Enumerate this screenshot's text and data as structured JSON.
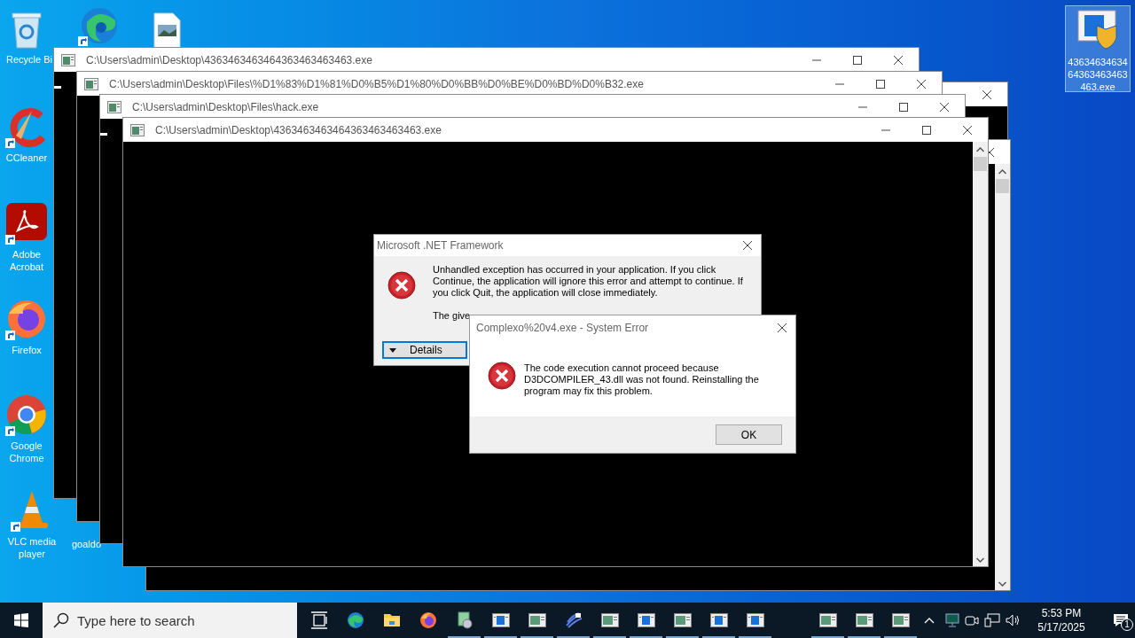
{
  "desktop_icons": [
    {
      "kind": "recycle-bin",
      "label": "Recycle Bi",
      "selected": false
    },
    {
      "kind": "edge",
      "selected": false
    },
    {
      "kind": "image-file",
      "selected": false
    },
    {
      "kind": "ccleaner",
      "label": "CCleaner",
      "selected": false
    },
    {
      "kind": "acrobat",
      "label": "Adobe Acrobat",
      "selected": false
    },
    {
      "kind": "firefox",
      "label": "Firefox",
      "selected": false
    },
    {
      "kind": "chrome",
      "label": "Google Chrome",
      "selected": false
    },
    {
      "kind": "vlc",
      "label": "VLC media player",
      "selected": false
    },
    {
      "kind": "hidden",
      "label": "goaldo",
      "selected": false
    },
    {
      "kind": "app",
      "label": "4363463463464363463463463.exe",
      "selected": true
    }
  ],
  "windows": [
    {
      "kind": "background"
    },
    {
      "kind": "background",
      "scrollbar": true
    },
    {
      "kind": "console",
      "title": "C:\\Users\\admin\\Desktop\\4363463463464363463463463.exe",
      "cursor": true
    },
    {
      "kind": "console",
      "title": "C:\\Users\\admin\\Desktop\\Files\\%D1%83%D1%81%D0%B5%D1%80%D0%BB%D0%BE%D0%BD%D0%B32.exe",
      "cursor": false
    },
    {
      "kind": "console",
      "title": "C:\\Users\\admin\\Desktop\\Files\\hack.exe",
      "cursor": true
    },
    {
      "kind": "console",
      "title": "C:\\Users\\admin\\Desktop\\4363463463464363463463463.exe",
      "cursor": false,
      "scrollbar": true
    }
  ],
  "net_dialog": {
    "title": "Microsoft .NET Framework",
    "message": "Unhandled exception has occurred in your application. If you click Continue, the application will ignore this error and attempt to continue. If you click Quit, the application will close immediately.",
    "detail": "The give",
    "details_button": "Details"
  },
  "system_error": {
    "title": "Complexo%20v4.exe - System Error",
    "message": "The code execution cannot proceed because D3DCOMPILER_43.dll was not found. Reinstalling the program may fix this problem.",
    "ok_button": "OK"
  },
  "taskbar": {
    "search": {
      "placeholder": "Type here to search"
    },
    "apps": [
      {
        "kind": "task-view",
        "running": false
      },
      {
        "kind": "edge",
        "running": false
      },
      {
        "kind": "folder",
        "running": false
      },
      {
        "kind": "firefox",
        "running": false
      },
      {
        "kind": "installer",
        "running": true
      },
      {
        "kind": "console-blue",
        "running": true
      },
      {
        "kind": "console-green",
        "running": true
      },
      {
        "kind": "wave",
        "running": true
      },
      {
        "kind": "console-green",
        "running": true
      },
      {
        "kind": "console-blue",
        "running": true
      },
      {
        "kind": "console-green",
        "running": true
      },
      {
        "kind": "console-blue",
        "running": true
      },
      {
        "kind": "console-blue",
        "running": true
      },
      {
        "kind": "gap",
        "running": false
      },
      {
        "kind": "console-green",
        "running": true
      },
      {
        "kind": "console-green",
        "running": true
      },
      {
        "kind": "console-green",
        "running": true
      }
    ],
    "time": "5:53 PM",
    "date": "5/17/2025",
    "notifications": "1"
  }
}
